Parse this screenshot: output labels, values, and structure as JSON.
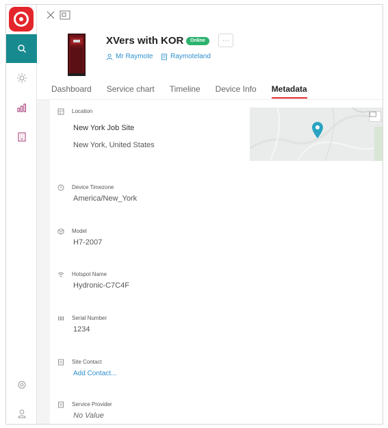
{
  "app": {
    "brand_color": "#e3262b",
    "accent_color": "#178a8f",
    "link_color": "#2c8fce"
  },
  "sidebar": {
    "items": [
      {
        "icon": "search-icon",
        "active": true
      },
      {
        "icon": "sun-icon",
        "active": false
      },
      {
        "icon": "analytics-icon",
        "active": false
      },
      {
        "icon": "building-icon",
        "active": false
      }
    ],
    "bottom": [
      {
        "icon": "settings-icon"
      },
      {
        "icon": "user-icon"
      }
    ]
  },
  "header": {
    "title": "XVers with KOR",
    "status": "Online",
    "more": "···",
    "owner": "Mr Raymote",
    "location": "Raymoteland"
  },
  "tabs": [
    {
      "label": "Dashboard",
      "active": false
    },
    {
      "label": "Service chart",
      "active": false
    },
    {
      "label": "Timeline",
      "active": false
    },
    {
      "label": "Device Info",
      "active": false
    },
    {
      "label": "Metadata",
      "active": true
    }
  ],
  "metadata": {
    "location": {
      "label": "Location",
      "name": "New York Job Site",
      "address": "New York, United States"
    },
    "timezone": {
      "label": "Device Timezone",
      "value": "America/New_York"
    },
    "model": {
      "label": "Model",
      "value": "H7-2007"
    },
    "hotspot": {
      "label": "Hotspot Name",
      "value": "Hydronic-C7C4F"
    },
    "serial": {
      "label": "Serial Number",
      "value": "1234"
    },
    "site_contact": {
      "label": "Site Contact",
      "action": "Add Contact..."
    },
    "service_provider": {
      "label": "Service Provider",
      "value": "No Value"
    }
  }
}
